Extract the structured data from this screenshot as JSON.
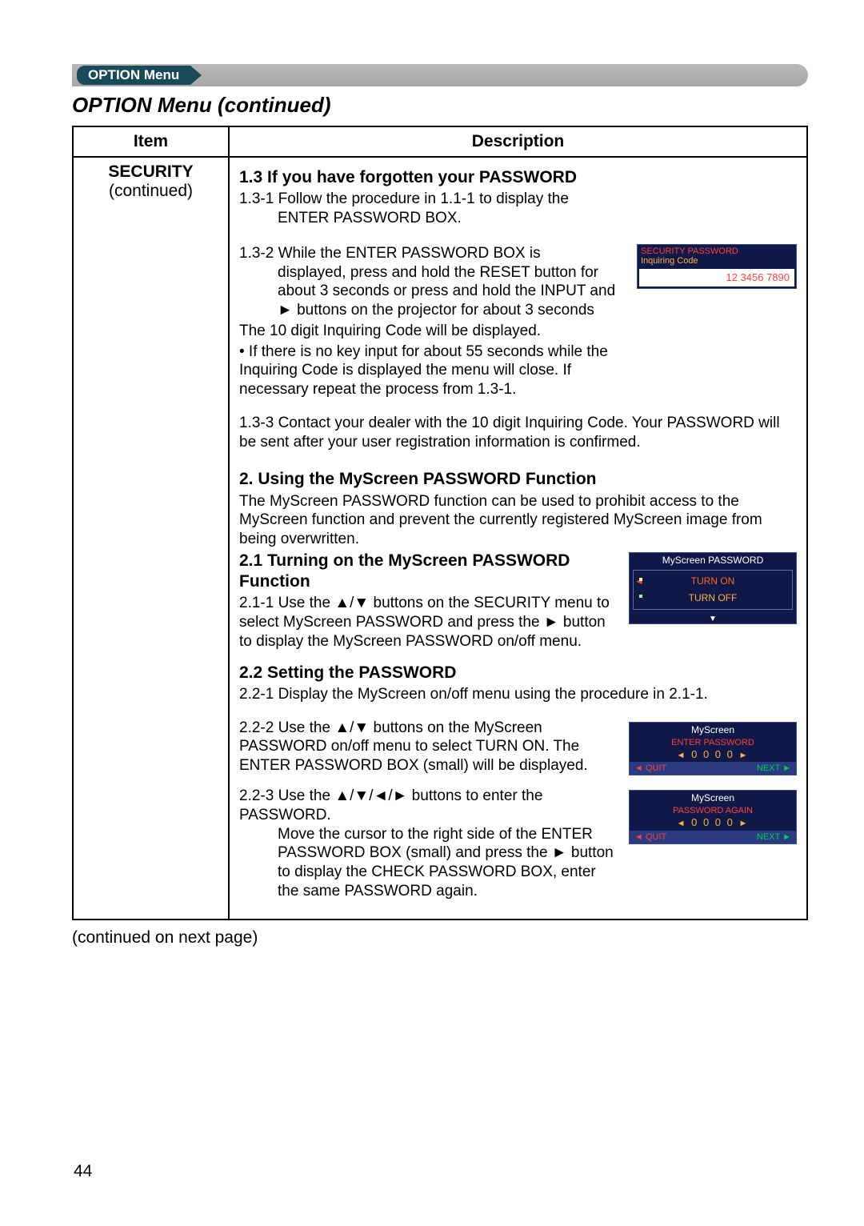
{
  "tab": {
    "label": "OPTION Menu"
  },
  "section_title": "OPTION Menu (continued)",
  "table": {
    "header_item": "Item",
    "header_desc": "Description",
    "item_name": "SECURITY",
    "item_sub": "(continued)"
  },
  "txt": {
    "h13": "1.3 If you have forgotten your PASSWORD",
    "p131a": "1.3-1 Follow the procedure in 1.1-1 to display the",
    "p131b": "ENTER PASSWORD BOX.",
    "p132a": "1.3-2 While the ENTER PASSWORD BOX is",
    "p132b": "displayed, press and hold the RESET button for about 3 seconds or press and hold the INPUT and ► buttons on the projector for about 3 seconds",
    "p132c": "The 10 digit Inquiring Code will be displayed.",
    "p132d": "• If there is no key input for about 55 seconds while the Inquiring Code is displayed the menu will close. If necessary repeat the process from 1.3-1.",
    "p133": "1.3-3 Contact your dealer with the 10 digit Inquiring Code. Your PASSWORD will be sent after your user registration information is confirmed.",
    "h2": "2. Using the MyScreen PASSWORD Function",
    "p2": "The MyScreen PASSWORD function can be used to prohibit access to the MyScreen function and prevent the currently registered MyScreen image from being overwritten.",
    "h21a": "2.1 Turning on the MyScreen PASSWORD",
    "h21b": "Function",
    "p211": "2.1-1 Use the ▲/▼ buttons on the SECURITY menu to select MyScreen PASSWORD and press the ► button to display the MyScreen PASSWORD on/off menu.",
    "h22": "2.2 Setting the PASSWORD",
    "p221": "2.2-1 Display the MyScreen on/off menu using the procedure in 2.1-1.",
    "p222": "2.2-2 Use the ▲/▼ buttons on the MyScreen PASSWORD on/off menu to select TURN ON. The ENTER PASSWORD BOX (small) will be displayed.",
    "p223": "2.2-3 Use the ▲/▼/◄/► buttons to enter the PASSWORD.",
    "p223b": "Move the cursor to the right side of the ENTER PASSWORD BOX (small) and press the ► button to display the CHECK PASSWORD BOX, enter the same PASSWORD again."
  },
  "osd1": {
    "title": "SECURITY PASSWORD",
    "sub": "Inquiring Code",
    "code": "12 3456 7890"
  },
  "osd2": {
    "title": "MyScreen PASSWORD",
    "opt1": "TURN ON",
    "opt2": "TURN OFF"
  },
  "osd3a": {
    "title": "MyScreen",
    "sub": "ENTER PASSWORD",
    "digits": "0 0 0 0",
    "quit": "QUIT",
    "next": "NEXT"
  },
  "osd3b": {
    "title": "MyScreen",
    "sub": "PASSWORD AGAIN",
    "digits": "0 0 0 0",
    "quit": "QUIT",
    "next": "NEXT"
  },
  "continued": "(continued on next page)",
  "pagenum": "44"
}
